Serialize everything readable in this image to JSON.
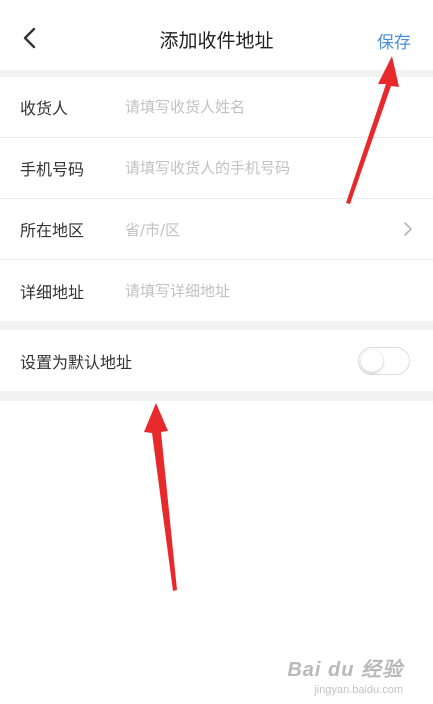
{
  "header": {
    "title": "添加收件地址",
    "save_label": "保存",
    "back_icon": "chevron-left-icon"
  },
  "form": {
    "rows": [
      {
        "label": "收货人",
        "placeholder": "请填写收货人姓名"
      },
      {
        "label": "手机号码",
        "placeholder": "请填写收货人的手机号码"
      },
      {
        "label": "所在地区",
        "placeholder": "省/市/区",
        "icon": "chevron-right-icon"
      },
      {
        "label": "详细地址",
        "placeholder": "请填写详细地址"
      }
    ]
  },
  "default_address": {
    "label": "设置为默认地址",
    "enabled": false
  },
  "watermark": {
    "logo": "Bai du 经验",
    "url": "jingyan.baidu.com"
  },
  "colors": {
    "accent": "#4a90d9",
    "annotation_arrow": "#e8292b",
    "separator": "#f2f2f2"
  }
}
